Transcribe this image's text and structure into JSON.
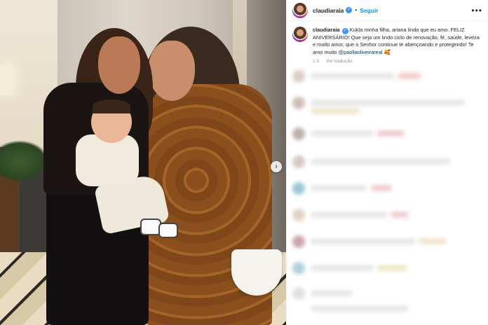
{
  "post": {
    "username": "claudiaraia",
    "follow_label": "Seguir",
    "more_label": "•••",
    "separator": "•",
    "verified_glyph": "✓",
    "caption": {
      "username": "claudiaraia",
      "text_before_mention": "Kukla minha filha, ariana linda que eu amo. FELIZ ANIVERSÁRIO! Que seja um lindo ciclo de renovação, fé, saúde, leveza e muito amor, que o Senhor continue te abençoando e protegendo! Te amo muito ",
      "mention": "@paollaoliveirareal",
      "emoji": "🥰",
      "time": "1 h",
      "translate_label": "Ver tradução"
    },
    "carousel_next_glyph": "›"
  },
  "colors": {
    "link": "#0095f6",
    "verified": "#3897f0",
    "mention": "#00376b"
  },
  "icons": [
    "verified-badge-icon",
    "more-options-icon",
    "carousel-next-icon"
  ]
}
